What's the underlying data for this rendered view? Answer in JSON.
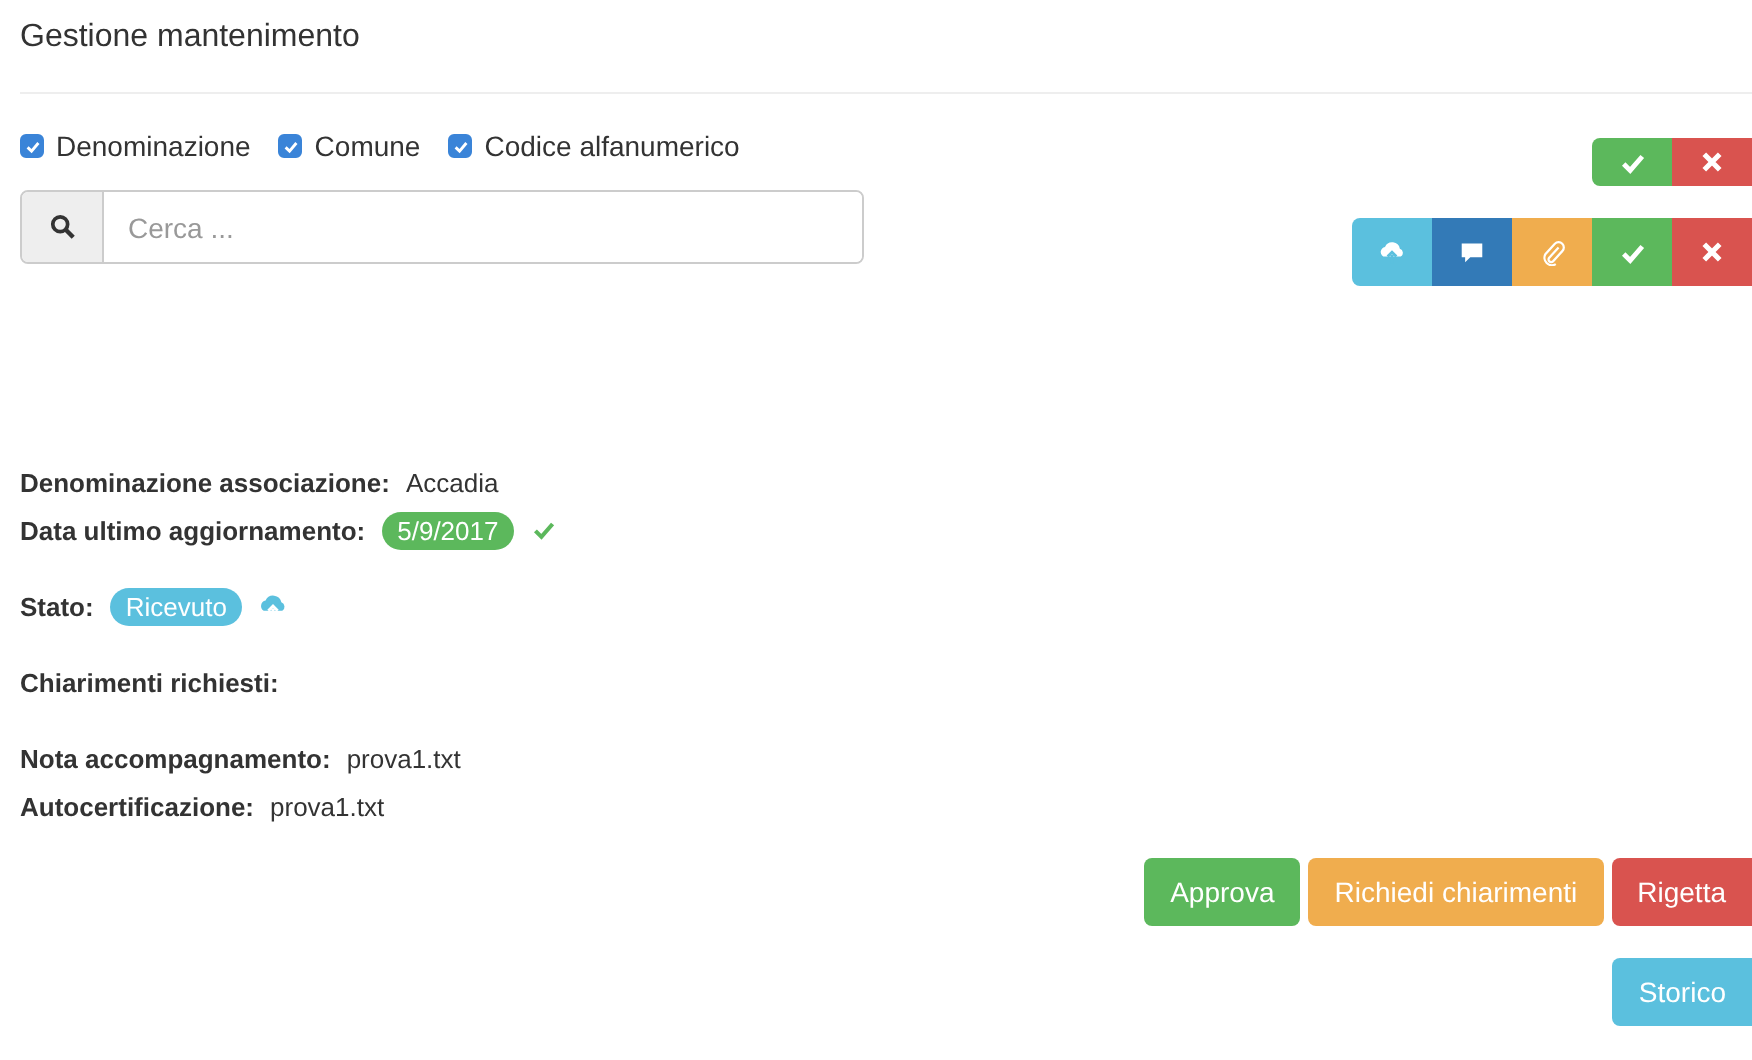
{
  "title": "Gestione mantenimento",
  "filters": [
    {
      "label": "Denominazione",
      "checked": true
    },
    {
      "label": "Comune",
      "checked": true
    },
    {
      "label": "Codice alfanumerico",
      "checked": true
    }
  ],
  "search": {
    "placeholder": "Cerca ..."
  },
  "toolbar_top": [
    {
      "kind": "approve"
    },
    {
      "kind": "reject"
    }
  ],
  "toolbar_bottom": [
    {
      "kind": "upload"
    },
    {
      "kind": "comment"
    },
    {
      "kind": "attach"
    },
    {
      "kind": "approve"
    },
    {
      "kind": "reject"
    }
  ],
  "details": [
    [
      {
        "label": "Denominazione associazione:",
        "value": "Accadia",
        "kind": "text"
      },
      {
        "label": "Data ultimo aggiornamento:",
        "value": "5/9/2017",
        "kind": "date"
      }
    ],
    [
      {
        "label": "Stato:",
        "value": "Ricevuto",
        "kind": "status"
      }
    ],
    [
      {
        "label": "Chiarimenti richiesti:",
        "kind": "text"
      }
    ],
    [
      {
        "label": "Nota accompagnamento:",
        "value": "prova1.txt",
        "kind": "text"
      },
      {
        "label": "Autocertificazione:",
        "value": "prova1.txt",
        "kind": "text"
      }
    ]
  ],
  "actions": [
    {
      "label": "Approva",
      "kind": "approve"
    },
    {
      "label": "Richiedi chiarimenti",
      "kind": "request"
    },
    {
      "label": "Rigetta",
      "kind": "reject"
    }
  ],
  "history_button": {
    "label": "Storico",
    "kind": "history"
  }
}
